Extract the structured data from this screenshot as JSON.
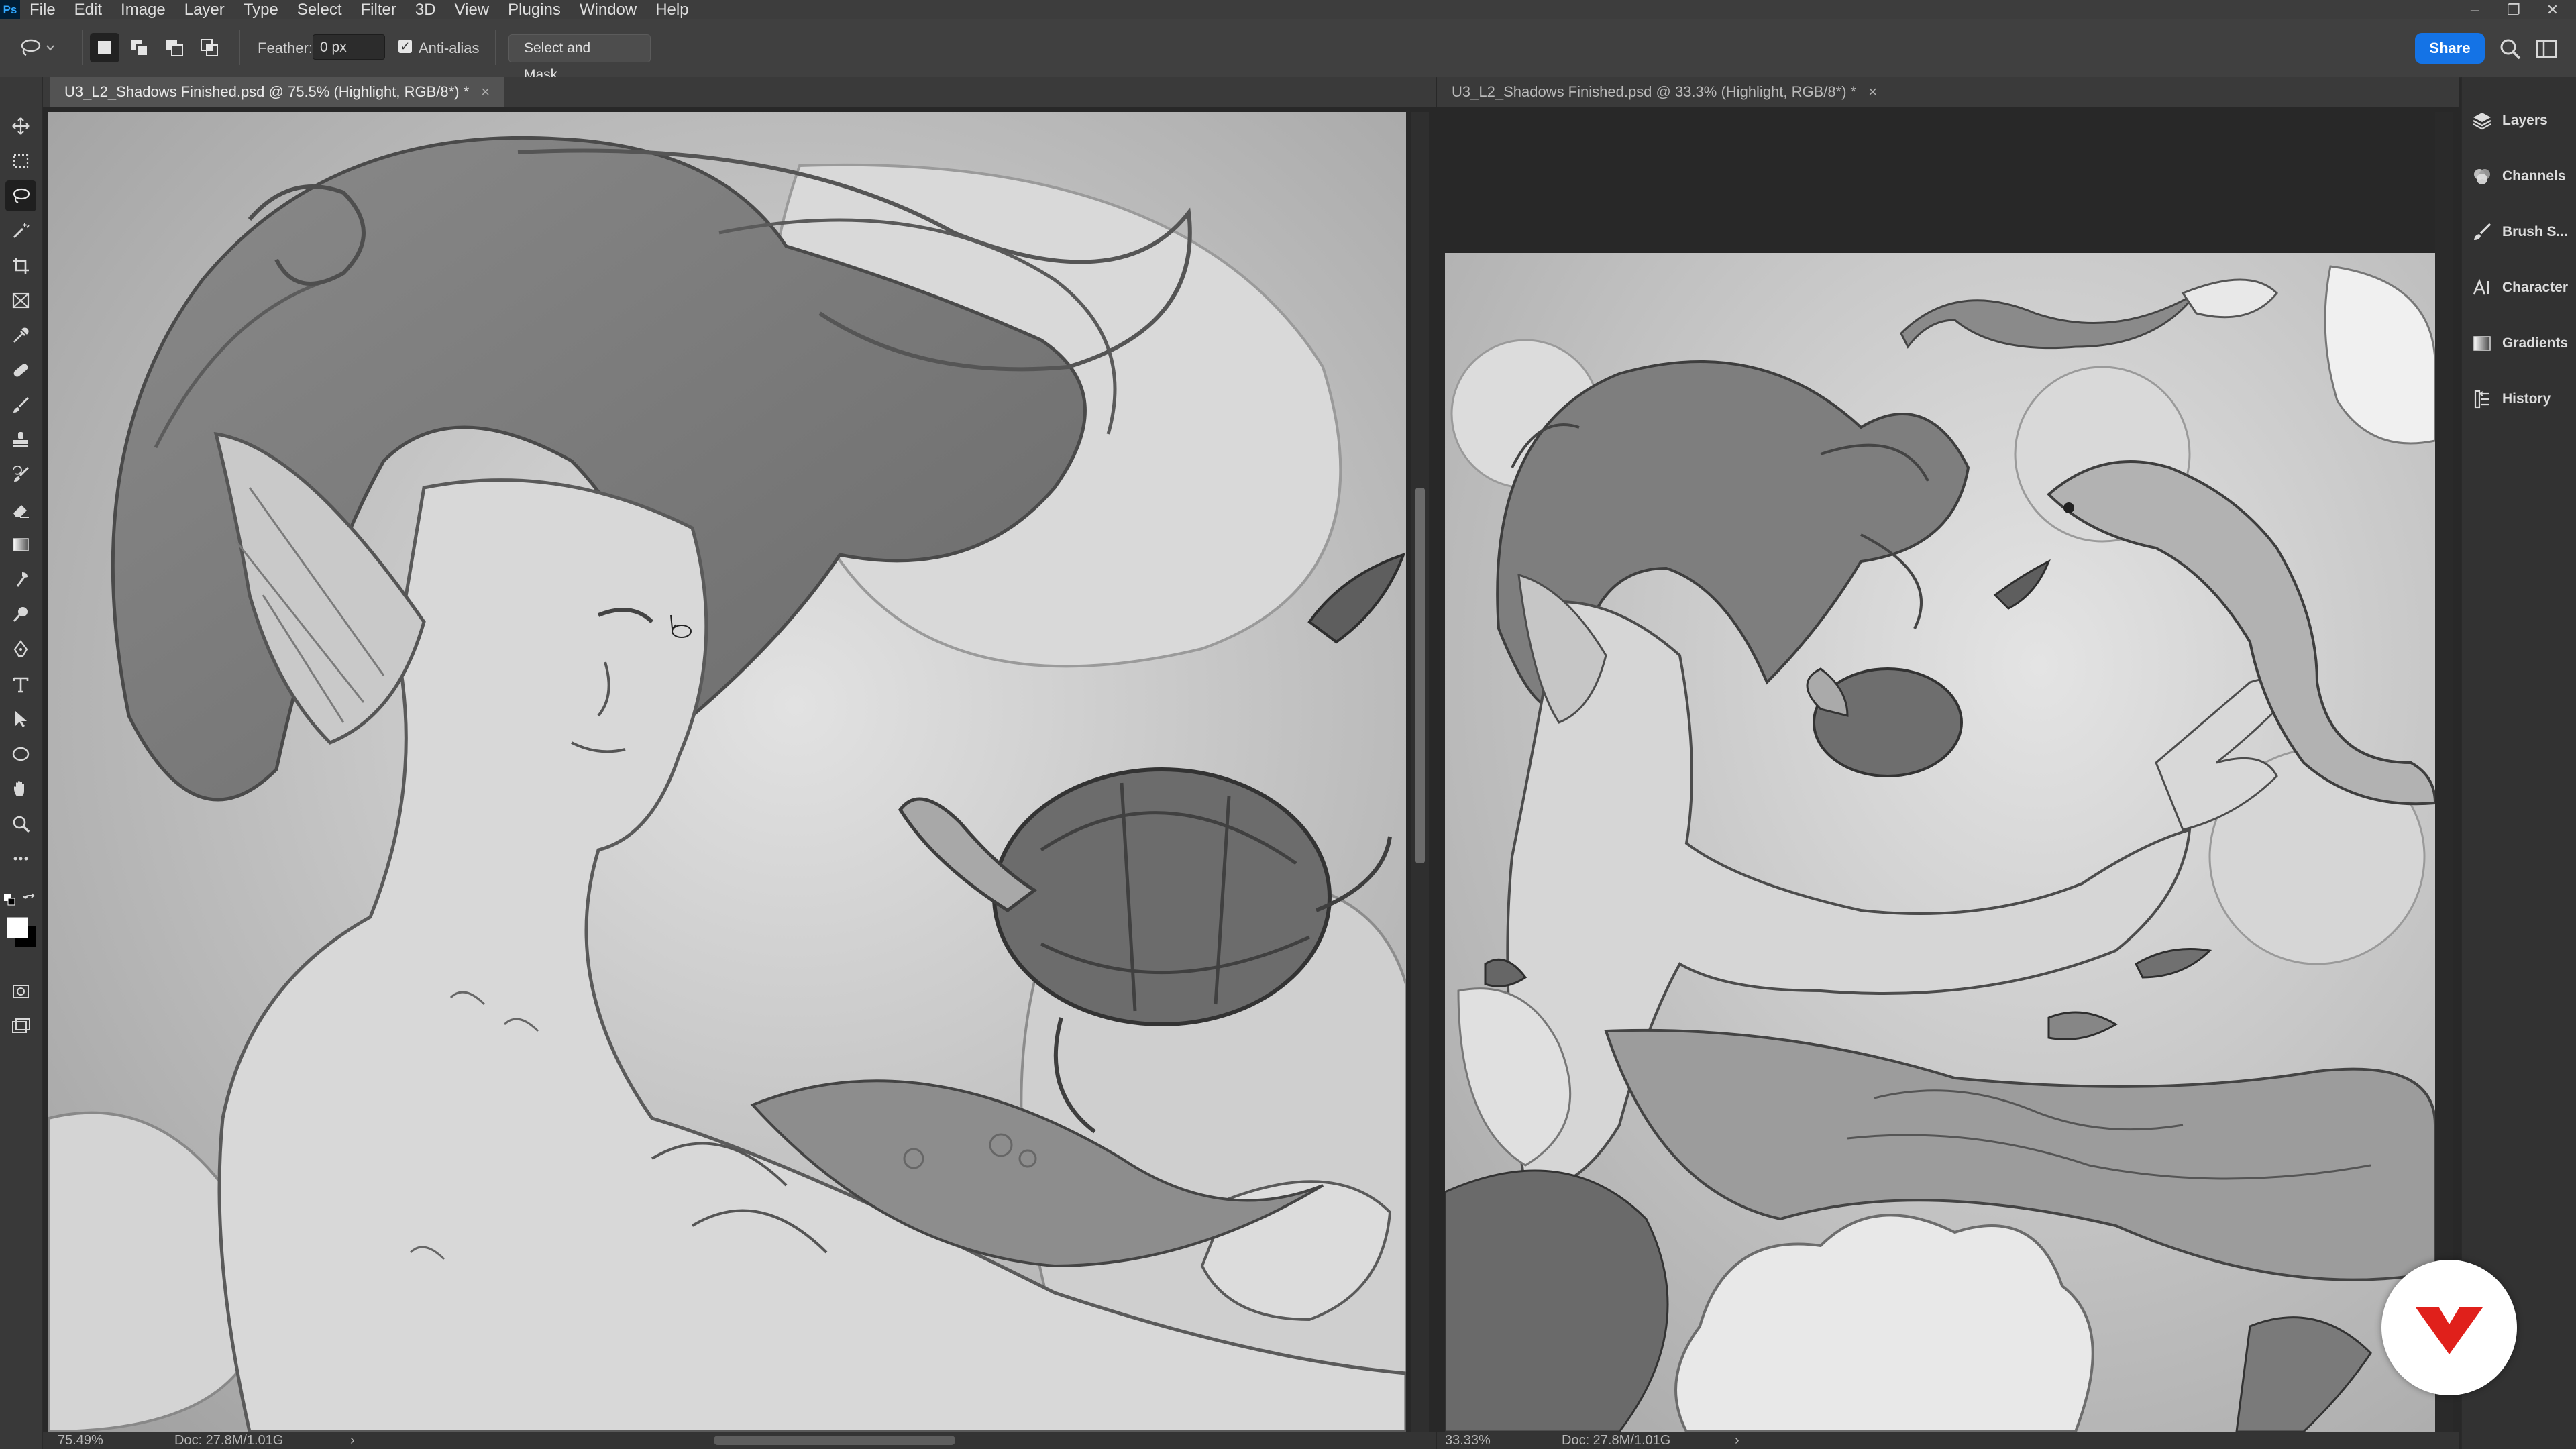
{
  "app": {
    "logo": "Ps"
  },
  "menu": [
    "File",
    "Edit",
    "Image",
    "Layer",
    "Type",
    "Select",
    "Filter",
    "3D",
    "View",
    "Plugins",
    "Window",
    "Help"
  ],
  "window_controls": {
    "minimize": "–",
    "restore": "❐",
    "close": "✕"
  },
  "options_bar": {
    "feather_label": "Feather:",
    "feather_value": "0 px",
    "antialias_label": "Anti-alias",
    "antialias_checked": true,
    "select_mask_label": "Select and Mask...",
    "share_label": "Share"
  },
  "tools": [
    "move-tool",
    "marquee-tool",
    "lasso-tool",
    "magic-wand-tool",
    "crop-tool",
    "frame-tool",
    "eyedropper-tool",
    "healing-tool",
    "brush-tool",
    "stamp-tool",
    "history-brush-tool",
    "eraser-tool",
    "gradient-tool",
    "blur-tool",
    "dodge-tool",
    "pen-tool",
    "type-tool",
    "path-select-tool",
    "shape-tool",
    "hand-tool",
    "zoom-tool",
    "more-tools"
  ],
  "active_tool": "lasso-tool",
  "documents": [
    {
      "tab_title": "U3_L2_Shadows Finished.psd @ 75.5% (Highlight, RGB/8*) *",
      "close": "×",
      "status_zoom": "75.49%",
      "status_doc": "Doc: 27.8M/1.01G",
      "status_arrow": "›"
    },
    {
      "tab_title": "U3_L2_Shadows Finished.psd @ 33.3% (Highlight, RGB/8*) *",
      "close": "×",
      "status_zoom": "33.33%",
      "status_doc": "Doc: 27.8M/1.01G",
      "status_arrow": "›"
    }
  ],
  "panels": [
    {
      "label": "Layers",
      "icon": "layers-icon"
    },
    {
      "label": "Channels",
      "icon": "channels-icon"
    },
    {
      "label": "Brush S...",
      "icon": "brush-settings-icon"
    },
    {
      "label": "Character",
      "icon": "character-icon"
    },
    {
      "label": "Gradients",
      "icon": "gradients-icon"
    },
    {
      "label": "History",
      "icon": "history-icon"
    }
  ],
  "colors": {
    "accent": "#1473e6",
    "brand": "#e0201b",
    "canvas_gray": "#bdbdbd"
  }
}
